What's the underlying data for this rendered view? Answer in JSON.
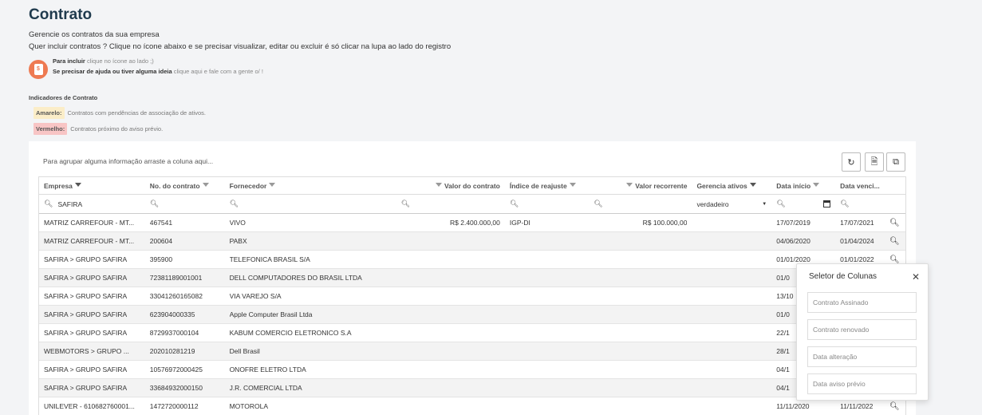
{
  "header": {
    "title": "Contrato",
    "subtitle": "Gerencie os contratos da sua empresa",
    "subtitle2": "Quer incluir contratos ? Clique no ícone abaixo e se precisar visualizar, editar ou excluir é só clicar na lupa ao lado do registro"
  },
  "help": {
    "line1_bold": "Para incluir",
    "line1_text": "clique no ícone ao lado ;)",
    "line2_bold": "Se precisar de ajuda ou tiver alguma ideia",
    "line2_text": "clique aqui e fale com a gente o/ !"
  },
  "indicators": {
    "title": "Indicadores de Contrato",
    "yellow_label": "Amarelo:",
    "yellow_text": "Contratos com pendências de associação de ativos.",
    "red_label": "Vermelho:",
    "red_text": "Contratos próximo do aviso prévio."
  },
  "grid": {
    "group_hint": "Para agrupar alguma informação arraste a coluna aqui...",
    "columns": [
      "Empresa",
      "No. do contrato",
      "Fornecedor",
      "Valor do contrato",
      "Índice de reajuste",
      "Valor recorrente",
      "Gerencia ativos",
      "Data início",
      "Data venci..."
    ],
    "filters": {
      "empresa": "SAFIRA",
      "gerencia": "verdadeiro"
    },
    "rows": [
      {
        "empresa": "MATRIZ CARREFOUR - MT...",
        "numero": "467541",
        "fornecedor": "VIVO",
        "valor": "R$ 2.400.000,00",
        "indice": "IGP-DI",
        "recorrente": "R$ 100.000,00",
        "inicio": "17/07/2019",
        "vencimento": "17/07/2021"
      },
      {
        "empresa": "MATRIZ CARREFOUR - MT...",
        "numero": "200604",
        "fornecedor": "PABX",
        "valor": "",
        "indice": "",
        "recorrente": "",
        "inicio": "04/06/2020",
        "vencimento": "01/04/2024"
      },
      {
        "empresa": "SAFIRA > GRUPO SAFIRA",
        "numero": "395900",
        "fornecedor": "TELEFONICA BRASIL S/A",
        "valor": "",
        "indice": "",
        "recorrente": "",
        "inicio": "01/01/2020",
        "vencimento": "01/01/2022"
      },
      {
        "empresa": "SAFIRA > GRUPO SAFIRA",
        "numero": "72381189001001",
        "fornecedor": "DELL COMPUTADORES DO BRASIL LTDA",
        "valor": "",
        "indice": "",
        "recorrente": "",
        "inicio": "01/0",
        "vencimento": ""
      },
      {
        "empresa": "SAFIRA > GRUPO SAFIRA",
        "numero": "33041260165082",
        "fornecedor": "VIA VAREJO S/A",
        "valor": "",
        "indice": "",
        "recorrente": "",
        "inicio": "13/10",
        "vencimento": ""
      },
      {
        "empresa": "SAFIRA > GRUPO SAFIRA",
        "numero": "623904000335",
        "fornecedor": "Apple Computer Brasil Ltda",
        "valor": "",
        "indice": "",
        "recorrente": "",
        "inicio": "01/0",
        "vencimento": ""
      },
      {
        "empresa": "SAFIRA > GRUPO SAFIRA",
        "numero": "8729937000104",
        "fornecedor": "KABUM COMERCIO ELETRONICO S.A",
        "valor": "",
        "indice": "",
        "recorrente": "",
        "inicio": "22/1",
        "vencimento": ""
      },
      {
        "empresa": "WEBMOTORS > GRUPO ...",
        "numero": "202010281219",
        "fornecedor": "Dell Brasil",
        "valor": "",
        "indice": "",
        "recorrente": "",
        "inicio": "28/1",
        "vencimento": ""
      },
      {
        "empresa": "SAFIRA > GRUPO SAFIRA",
        "numero": "10576972000425",
        "fornecedor": "ONOFRE ELETRO LTDA",
        "valor": "",
        "indice": "",
        "recorrente": "",
        "inicio": "04/1",
        "vencimento": ""
      },
      {
        "empresa": "SAFIRA > GRUPO SAFIRA",
        "numero": "33684932000150",
        "fornecedor": "J.R. COMERCIAL LTDA",
        "valor": "",
        "indice": "",
        "recorrente": "",
        "inicio": "04/1",
        "vencimento": ""
      },
      {
        "empresa": "UNILEVER - 610682760001...",
        "numero": "1472720000112",
        "fornecedor": "MOTOROLA",
        "valor": "",
        "indice": "",
        "recorrente": "",
        "inicio": "11/11/2020",
        "vencimento": "11/11/2022"
      }
    ]
  },
  "selector": {
    "title": "Seletor de Colunas",
    "options": [
      "Contrato Assinado",
      "Contrato renovado",
      "Data alteração",
      "Data aviso prévio"
    ]
  }
}
